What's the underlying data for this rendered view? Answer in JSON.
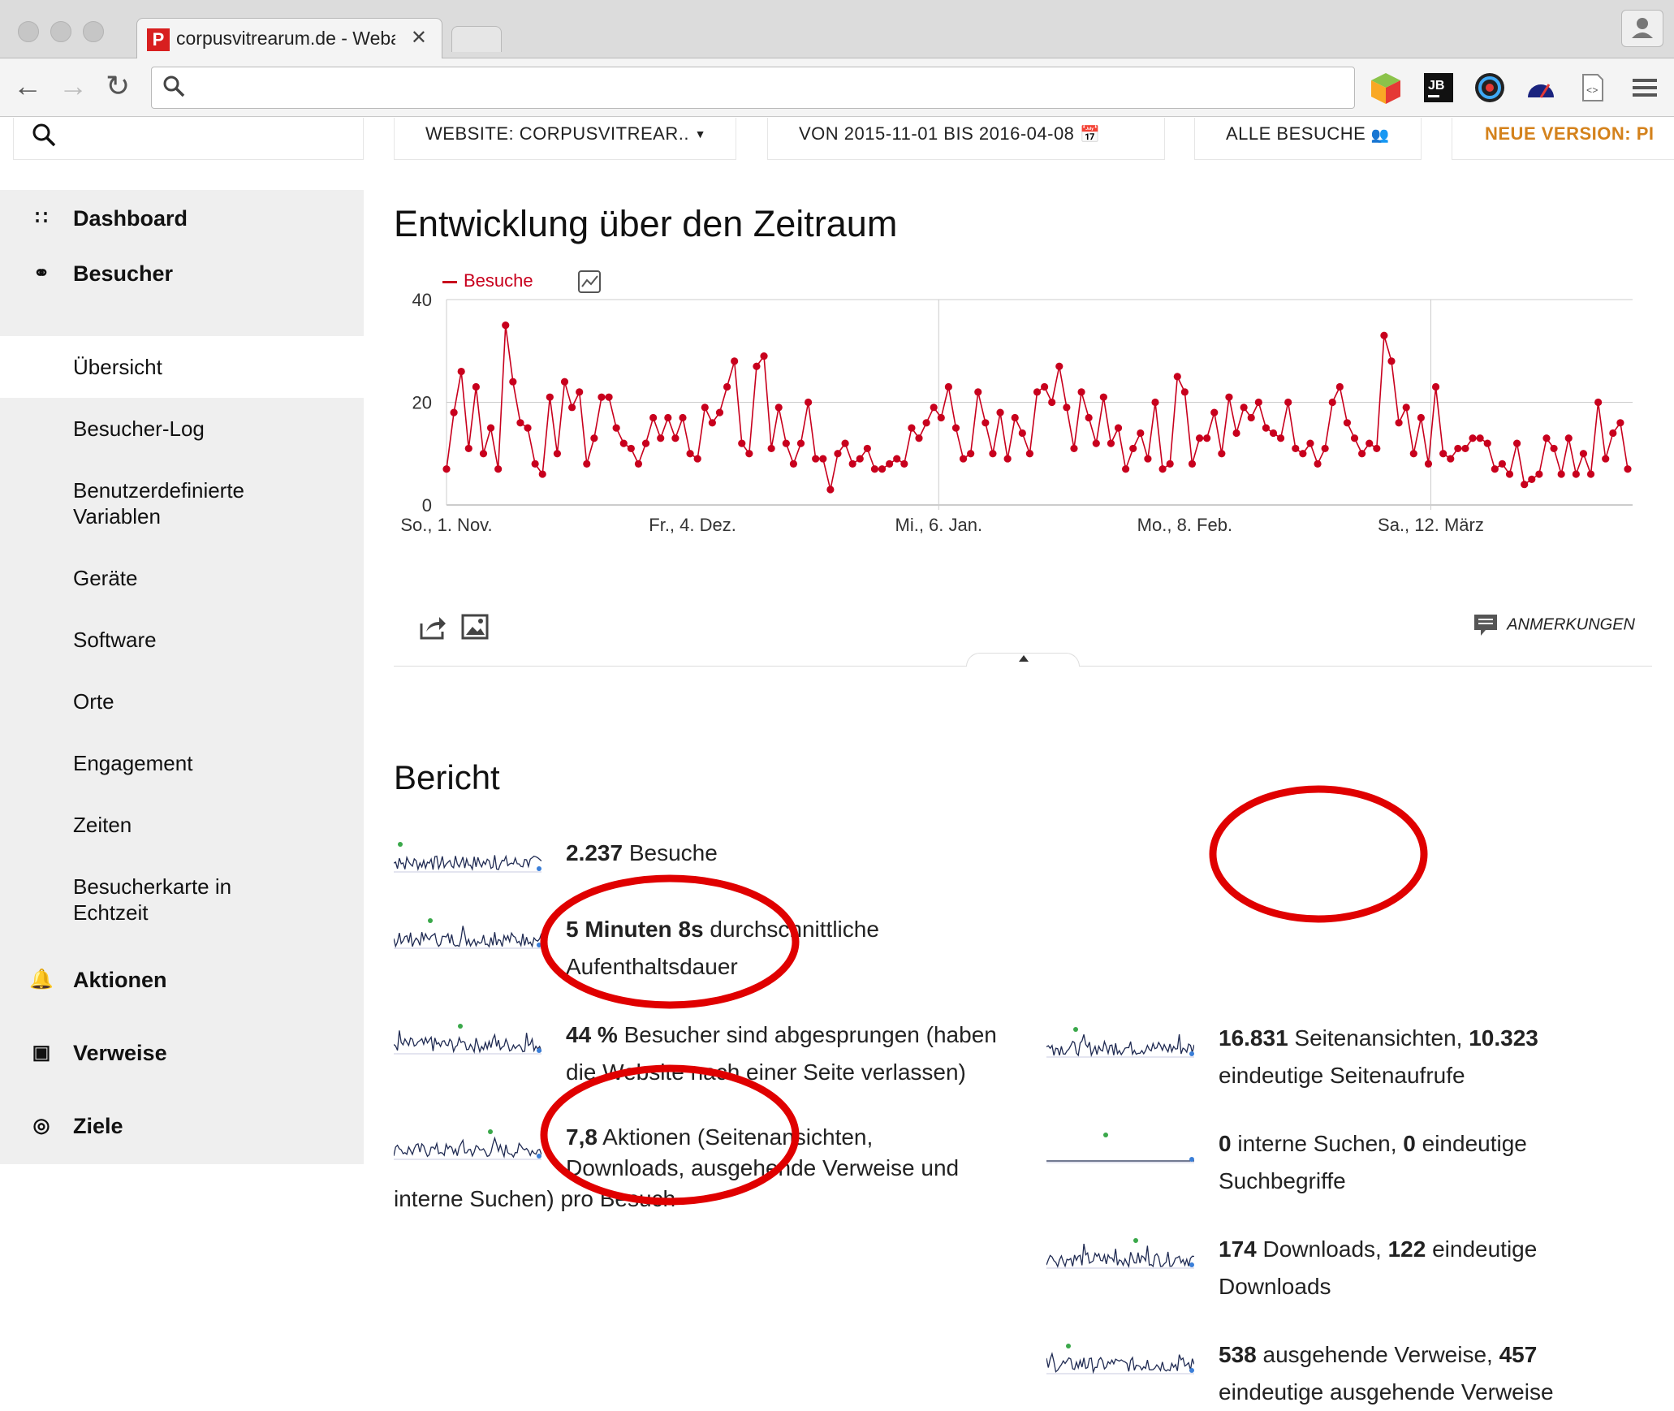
{
  "browser": {
    "tab_title": "corpusvitrearum.de - Weba",
    "tab_favicon_letter": "P",
    "tab_close": "✕"
  },
  "top_bar": {
    "website_selector": "WEBSITE: CORPUSVITREAR..",
    "date_range": "VON 2015-11-01 BIS 2016-04-08",
    "segment": "ALLE BESUCHE",
    "new_version": "NEUE VERSION: PI"
  },
  "sidebar": {
    "items": [
      {
        "label": "Dashboard",
        "icon": "grid-icon"
      },
      {
        "label": "Besucher",
        "icon": "binoculars-icon"
      }
    ],
    "sub_items": [
      "Übersicht",
      "Besucher-Log",
      "Benutzerdefinierte Variablen",
      "Geräte",
      "Software",
      "Orte",
      "Engagement",
      "Zeiten",
      "Besucherkarte in Echtzeit"
    ],
    "bottom_items": [
      {
        "label": "Aktionen",
        "icon": "bell-icon"
      },
      {
        "label": "Verweise",
        "icon": "browser-window-icon"
      },
      {
        "label": "Ziele",
        "icon": "target-icon"
      }
    ]
  },
  "evolution": {
    "title": "Entwicklung über den Zeitraum",
    "annotations_label": "ANMERKUNGEN"
  },
  "chart_data": {
    "type": "line",
    "series": [
      {
        "name": "Besuche",
        "color": "#c8001d",
        "values": [
          7,
          18,
          26,
          11,
          23,
          10,
          15,
          7,
          35,
          24,
          16,
          15,
          8,
          6,
          21,
          10,
          24,
          19,
          22,
          8,
          13,
          21,
          21,
          15,
          12,
          11,
          8,
          12,
          17,
          13,
          17,
          13,
          17,
          10,
          9,
          19,
          16,
          18,
          23,
          28,
          12,
          10,
          27,
          29,
          11,
          19,
          12,
          8,
          12,
          20,
          9,
          9,
          3,
          10,
          12,
          8,
          9,
          11,
          7,
          7,
          8,
          9,
          8,
          15,
          13,
          16,
          19,
          17,
          23,
          15,
          9,
          10,
          22,
          16,
          10,
          18,
          9,
          17,
          14,
          10,
          22,
          23,
          20,
          27,
          19,
          11,
          22,
          17,
          12,
          21,
          12,
          15,
          7,
          11,
          14,
          9,
          20,
          7,
          8,
          25,
          22,
          8,
          13,
          13,
          18,
          10,
          21,
          14,
          19,
          17,
          20,
          15,
          14,
          13,
          20,
          11,
          10,
          12,
          8,
          11,
          20,
          23,
          16,
          13,
          10,
          12,
          11,
          33,
          28,
          16,
          19,
          10,
          17,
          8,
          23,
          10,
          9,
          11,
          11,
          13,
          13,
          12,
          7,
          8,
          6,
          12,
          4,
          5,
          6,
          13,
          11,
          6,
          13,
          6,
          10,
          6,
          20,
          9,
          14,
          16,
          7
        ]
      }
    ],
    "x_tick_labels": [
      "So., 1. Nov.",
      "Fr., 4. Dez.",
      "Mi., 6. Jan.",
      "Mo., 8. Feb.",
      "Sa., 12. März"
    ],
    "y_ticks": [
      0,
      20,
      40
    ],
    "ylim": [
      0,
      40
    ],
    "x_range": [
      "2015-11-01",
      "2016-04-08"
    ],
    "grid": true
  },
  "report": {
    "title": "Bericht",
    "left": [
      {
        "bold": "2.237",
        "text": " Besuche"
      },
      {
        "bold": "5 Minuten 8s",
        "text": " durchschnittliche Aufenthaltsdauer"
      },
      {
        "bold": "44 %",
        "text": " Besucher sind abgesprungen (haben die Website nach einer Seite verlassen)"
      },
      {
        "bold": "7,8",
        "text": " Aktionen (Seitenansichten, Downloads, ausgehende Verweise und interne Suchen) pro Besuch"
      }
    ],
    "right": [
      {
        "b1": "16.831",
        "t1": " Seitenansichten, ",
        "b2": "10.323",
        "t2": " eindeutige Seitenaufrufe"
      },
      {
        "b1": "0",
        "t1": " interne Suchen, ",
        "b2": "0",
        "t2": " eindeutige Suchbegriffe"
      },
      {
        "b1": "174",
        "t1": " Downloads, ",
        "b2": "122",
        "t2": " eindeutige Downloads"
      },
      {
        "b1": "538",
        "t1": " ausgehende Verweise, ",
        "b2": "457",
        "t2": " eindeutige ausgehende Verweise"
      }
    ]
  },
  "colors": {
    "accent_red": "#c8001d",
    "highlight_circle": "#e00000",
    "new_version": "#d4821c"
  }
}
